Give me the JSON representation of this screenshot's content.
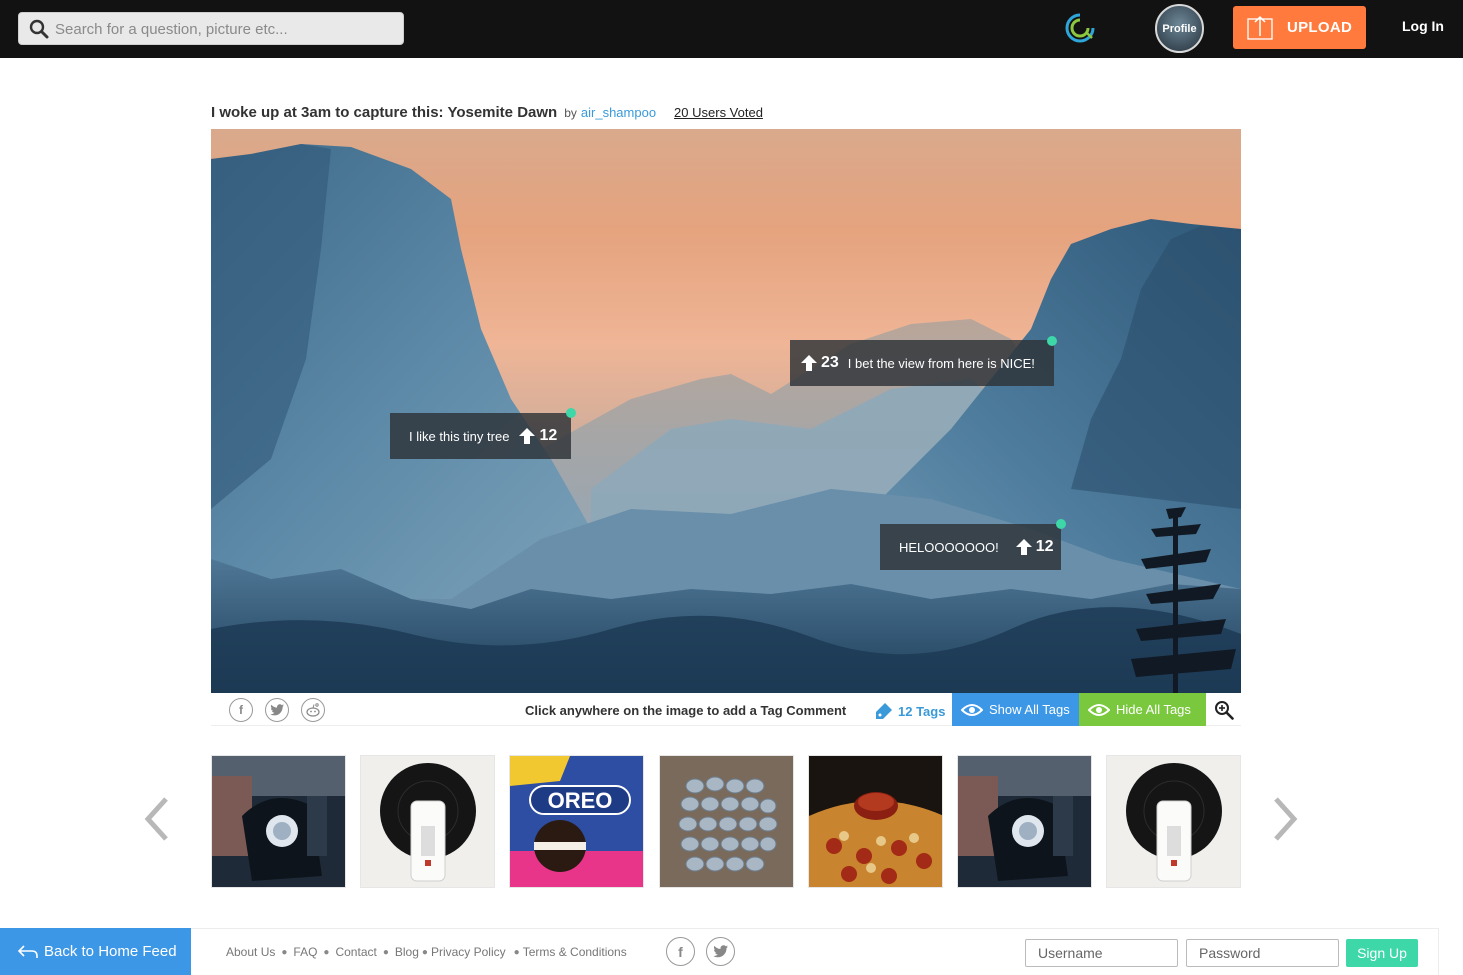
{
  "search": {
    "placeholder": "Search for a question, picture etc..."
  },
  "header": {
    "profile_label": "Profile",
    "upload_label": "UPLOAD",
    "login_label": "Log In"
  },
  "post": {
    "title": "I woke up at 3am to capture this: Yosemite Dawn",
    "by_label": "by",
    "author": "air_shampoo",
    "voted": "20 Users Voted"
  },
  "tags": [
    {
      "text": "I bet the view from here is NICE!",
      "votes": "23"
    },
    {
      "text": "I like this tiny tree",
      "votes": "12"
    },
    {
      "text": "HELOOOOOOO!",
      "votes": "12"
    }
  ],
  "toolbar": {
    "hint": "Click anywhere on the image to add a Tag Comment",
    "tags_count": "12 Tags",
    "show_all": "Show All Tags",
    "hide_all": "Hide All Tags"
  },
  "footer": {
    "back_label": "Back to Home Feed",
    "links": [
      "About Us",
      "FAQ",
      "Contact",
      "Blog",
      "Privacy Policy",
      "Terms & Conditions"
    ],
    "username_placeholder": "Username",
    "password_placeholder": "Password",
    "signup_label": "Sign Up"
  },
  "colors": {
    "topbar": "#121212",
    "upload": "#ff7a3c",
    "blue": "#3c97e6",
    "green": "#79c83e",
    "teal": "#3ed7a8",
    "link": "#3a9ad9"
  }
}
